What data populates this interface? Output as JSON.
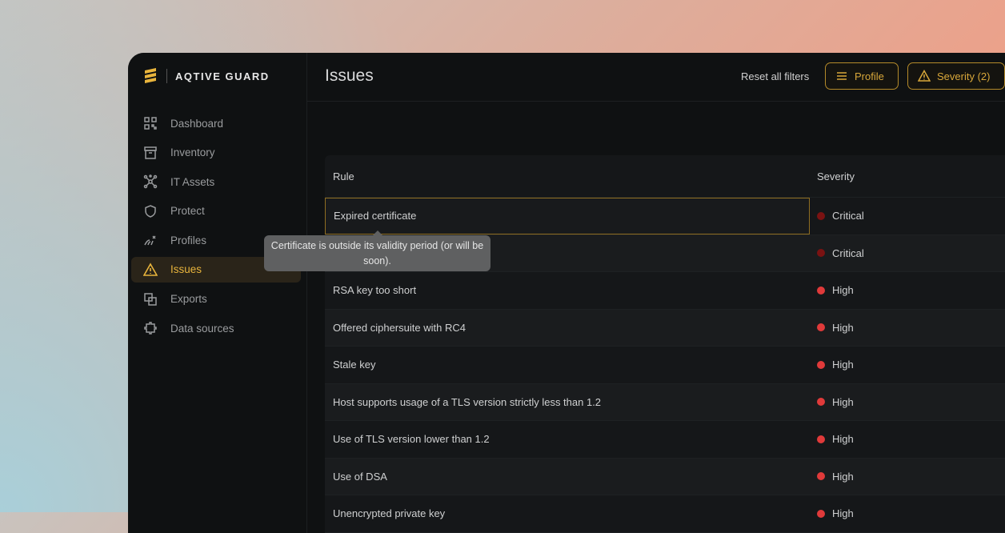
{
  "brand": {
    "name": "AQTIVE GUARD"
  },
  "sidebar": {
    "items": [
      {
        "label": "Dashboard",
        "icon": "grid-icon",
        "active": false
      },
      {
        "label": "Inventory",
        "icon": "archive-icon",
        "active": false
      },
      {
        "label": "IT Assets",
        "icon": "network-icon",
        "active": false
      },
      {
        "label": "Protect",
        "icon": "shield-icon",
        "active": false
      },
      {
        "label": "Profiles",
        "icon": "profile-fingerprint-icon",
        "active": false
      },
      {
        "label": "Issues",
        "icon": "warning-icon",
        "active": true
      },
      {
        "label": "Exports",
        "icon": "export-icon",
        "active": false
      },
      {
        "label": "Data sources",
        "icon": "plug-icon",
        "active": false
      }
    ]
  },
  "header": {
    "title": "Issues",
    "reset_label": "Reset all filters",
    "profile_filter_label": "Profile",
    "severity_filter_label": "Severity (2)"
  },
  "table": {
    "columns": {
      "rule": "Rule",
      "severity": "Severity"
    },
    "rows": [
      {
        "rule": "Expired certificate",
        "severity": "Critical",
        "color": "#7a1212"
      },
      {
        "rule": "",
        "severity": "Critical",
        "color": "#7a1212"
      },
      {
        "rule": "RSA key too short",
        "severity": "High",
        "color": "#e03a3a"
      },
      {
        "rule": "Offered ciphersuite with RC4",
        "severity": "High",
        "color": "#e03a3a"
      },
      {
        "rule": "Stale key",
        "severity": "High",
        "color": "#e03a3a"
      },
      {
        "rule": "Host supports usage of a TLS version strictly less than 1.2",
        "severity": "High",
        "color": "#e03a3a"
      },
      {
        "rule": "Use of TLS version lower than 1.2",
        "severity": "High",
        "color": "#e03a3a"
      },
      {
        "rule": "Use of DSA",
        "severity": "High",
        "color": "#e03a3a"
      },
      {
        "rule": "Unencrypted private key",
        "severity": "High",
        "color": "#e03a3a"
      }
    ]
  },
  "tooltip": {
    "text": "Certificate is outside its validity period (or will be soon)."
  },
  "colors": {
    "accent": "#e8b43c",
    "critical": "#7a1212",
    "high": "#e03a3a"
  }
}
